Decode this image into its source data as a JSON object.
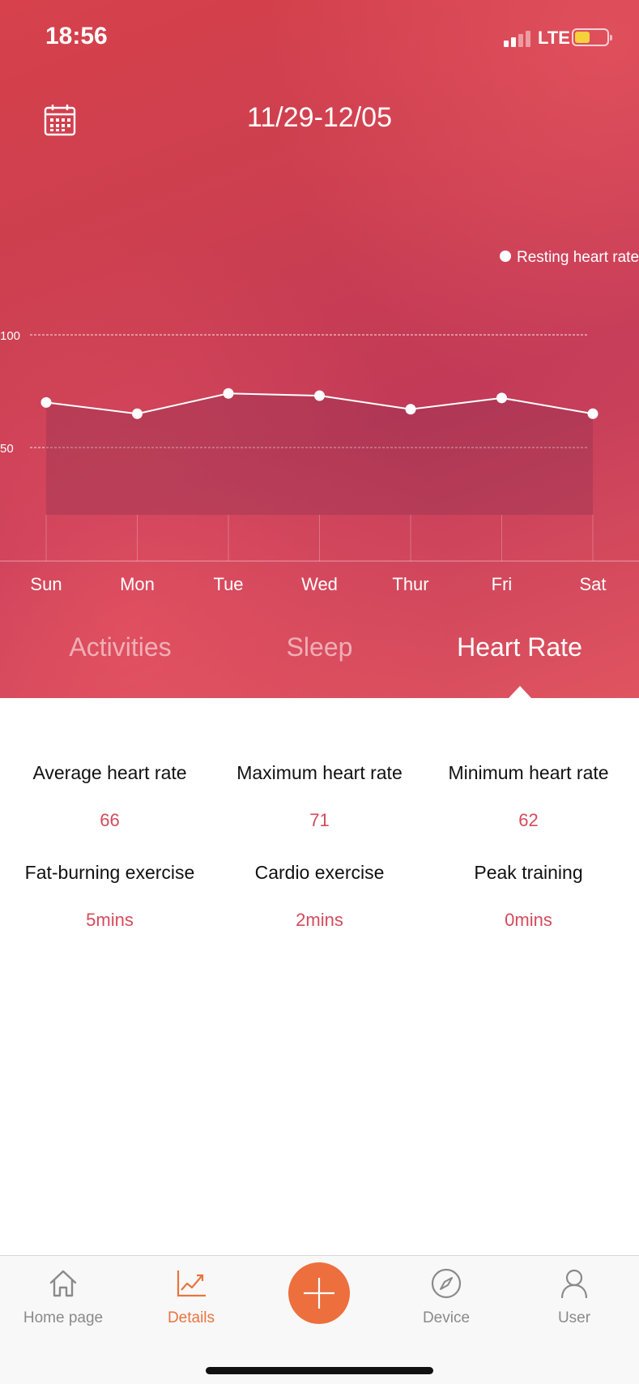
{
  "status_bar": {
    "time": "18:56",
    "network": "LTE"
  },
  "header": {
    "date_range": "11/29-12/05",
    "calendar_icon": "calendar-icon"
  },
  "chart_data": {
    "type": "area",
    "legend": "Resting heart rate",
    "legend_position": "top-right",
    "categories": [
      "Sun",
      "Mon",
      "Tue",
      "Wed",
      "Thur",
      "Fri",
      "Sat"
    ],
    "series": [
      {
        "name": "Resting heart rate",
        "values": [
          70,
          65,
          74,
          73,
          67,
          72,
          65
        ]
      }
    ],
    "ylim": [
      0,
      100
    ],
    "yticks": [
      100,
      50
    ],
    "grid": true
  },
  "tabs": [
    {
      "label": "Activities",
      "active": false
    },
    {
      "label": "Sleep",
      "active": false
    },
    {
      "label": "Heart Rate",
      "active": true
    }
  ],
  "stats": [
    [
      {
        "label": "Average heart rate",
        "value": "66"
      },
      {
        "label": "Maximum heart rate",
        "value": "71"
      },
      {
        "label": "Minimum heart rate",
        "value": "62"
      }
    ],
    [
      {
        "label": "Fat-burning exercise",
        "value": "5mins"
      },
      {
        "label": "Cardio exercise",
        "value": "2mins"
      },
      {
        "label": "Peak training",
        "value": "0mins"
      }
    ]
  ],
  "tabbar": {
    "home": "Home page",
    "details": "Details",
    "device": "Device",
    "user": "User"
  },
  "colors": {
    "accent": "#ec6f3d",
    "stat_value": "#d44a5c",
    "hero": "#cd3f4f"
  }
}
